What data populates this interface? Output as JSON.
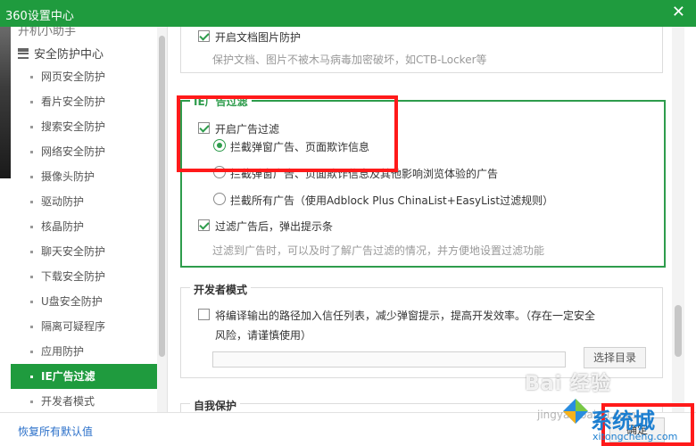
{
  "window": {
    "title": "360设置中心",
    "close_glyph": "✕"
  },
  "sidebar": {
    "prev_item": "开机小助手",
    "group_label": "安全防护中心",
    "items": [
      {
        "label": "网页安全防护"
      },
      {
        "label": "看片安全防护"
      },
      {
        "label": "搜索安全防护"
      },
      {
        "label": "网络安全防护"
      },
      {
        "label": "摄像头防护"
      },
      {
        "label": "驱动防护"
      },
      {
        "label": "核晶防护"
      },
      {
        "label": "聊天安全防护"
      },
      {
        "label": "下载安全防护"
      },
      {
        "label": "U盘安全防护"
      },
      {
        "label": "隔离可疑程序"
      },
      {
        "label": "应用防护"
      },
      {
        "label": "IE广告过滤"
      },
      {
        "label": "开发者模式"
      }
    ],
    "active_label": "IE广告过滤"
  },
  "bottom": {
    "reset_label": "恢复所有默认值",
    "ok_label": "确定"
  },
  "doc_protect": {
    "checkbox_label": "开启文档图片防护",
    "description": "保护文档、图片不被木马病毒加密破坏，如CTB-Locker等",
    "checked": true
  },
  "ie_filter": {
    "legend": "IE广告过滤",
    "enable_label": "开启广告过滤",
    "enable_checked": true,
    "options": [
      {
        "label": "拦截弹窗广告、页面欺诈信息",
        "selected": true
      },
      {
        "label": "拦截弹窗广告、页面欺诈信息及其他影响浏览体验的广告",
        "selected": false
      },
      {
        "label": "拦截所有广告（使用Adblock Plus ChinaList+EasyList过滤规则）",
        "selected": false
      }
    ],
    "popup_label": "过滤广告后，弹出提示条",
    "popup_checked": true,
    "popup_desc": "过滤到广告时，可以及时了解广告过滤的情况，并方便地设置过滤功能"
  },
  "dev_mode": {
    "legend": "开发者模式",
    "checkbox_label_line1": "将编译输出的路径加入信任列表，减少弹窗提示，提高开发效率。（存在一定安全",
    "checkbox_label_line2": "风险，请谨慎使用）",
    "checked": false,
    "path_value": "",
    "select_dir_label": "选择目录"
  },
  "self_protect": {
    "legend": "自我保护"
  },
  "watermarks": {
    "baidu": "Bai 经验",
    "jingyan_url": "jingyan.baidu.com",
    "site_logo": "系统城",
    "site_url": "xitongcheng.com"
  },
  "colors": {
    "accent": "#1f9b3e",
    "annotation": "#ff1a1a",
    "link": "#2a6fc9"
  }
}
